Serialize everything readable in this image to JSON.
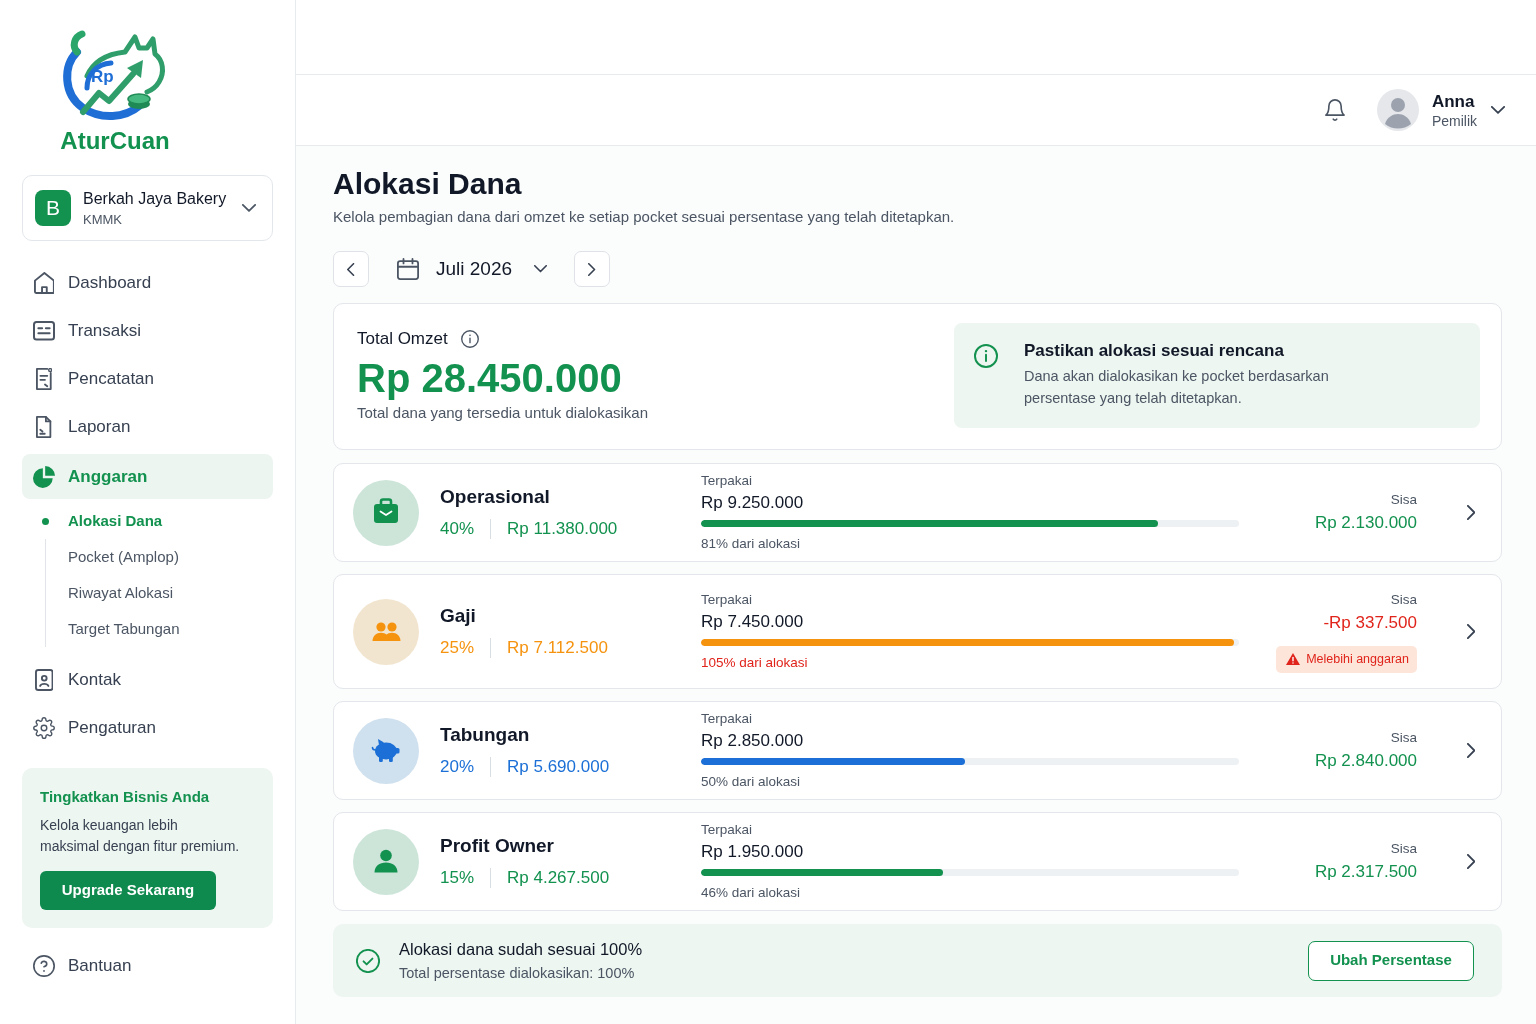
{
  "brand": {
    "mark": "Rp",
    "name": "AturCuan"
  },
  "business": {
    "initial": "B",
    "name": "Berkah Jaya Bakery",
    "type": "KMMK"
  },
  "nav": [
    {
      "kind": "dashboard",
      "label": "Dashboard",
      "selected": false
    },
    {
      "kind": "transactions",
      "label": "Transaksi",
      "selected": false
    },
    {
      "kind": "records",
      "label": "Pencatatan",
      "selected": false
    },
    {
      "kind": "reports",
      "label": "Laporan",
      "selected": false
    },
    {
      "kind": "budget",
      "label": "Anggaran",
      "selected": true,
      "children": [
        {
          "label": "Alokasi Dana",
          "selected": true
        },
        {
          "label": "Pocket (Amplop)",
          "selected": false
        },
        {
          "label": "Riwayat Alokasi",
          "selected": false
        },
        {
          "label": "Target Tabungan",
          "selected": false
        }
      ]
    },
    {
      "kind": "contacts",
      "label": "Kontak",
      "selected": false
    },
    {
      "kind": "settings",
      "label": "Pengaturan",
      "selected": false
    }
  ],
  "upgrade": {
    "title": "Tingkatkan Bisnis Anda",
    "text": "Kelola keuangan lebih maksimal dengan fitur premium.",
    "button": "Upgrade Sekarang"
  },
  "help": {
    "label": "Bantuan"
  },
  "user": {
    "name": "Anna",
    "role": "Pemilik"
  },
  "page": {
    "title": "Alokasi Dana",
    "subtitle": "Kelola pembagian dana dari omzet ke setiap pocket sesuai persentase yang telah ditetapkan."
  },
  "period": {
    "label": "Juli 2026"
  },
  "summary": {
    "label": "Total Omzet",
    "amount": "Rp 28.450.000",
    "caption": "Total dana yang tersedia untuk dialokasikan"
  },
  "notice": {
    "title": "Pastikan alokasi sesuai rencana",
    "text": "Dana akan dialokasikan ke pocket berdasarkan persentase yang telah ditetapkan."
  },
  "pockets": [
    {
      "kind": "operations",
      "name": "Operasional",
      "color": "#12914f",
      "percent": "40%",
      "allocation": "Rp 11.380.000",
      "used_label": "Terpakai",
      "used": "Rp 9.250.000",
      "level": 0.85,
      "usage": "81% dari alokasi",
      "remaining_label": "Sisa",
      "remaining": "Rp 2.130.000",
      "over_budget": false
    },
    {
      "kind": "payroll",
      "name": "Gaji",
      "color": "#f5930f",
      "percent": "25%",
      "allocation": "Rp 7.112.500",
      "used_label": "Terpakai",
      "used": "Rp 7.450.000",
      "level": 0.99,
      "usage": "105% dari alokasi",
      "remaining_label": "Sisa",
      "remaining": "-Rp 337.500",
      "over_budget": true,
      "warning": "Melebihi anggaran"
    },
    {
      "kind": "savings",
      "name": "Tabungan",
      "color": "#1b6fd6",
      "percent": "20%",
      "allocation": "Rp 5.690.000",
      "used_label": "Terpakai",
      "used": "Rp 2.850.000",
      "level": 0.49,
      "usage": "50% dari alokasi",
      "remaining_label": "Sisa",
      "remaining": "Rp 2.840.000",
      "over_budget": false
    },
    {
      "kind": "owner",
      "name": "Profit Owner",
      "color": "#12914f",
      "percent": "15%",
      "allocation": "Rp 4.267.500",
      "used_label": "Terpakai",
      "used": "Rp 1.950.000",
      "level": 0.45,
      "usage": "46% dari alokasi",
      "remaining_label": "Sisa",
      "remaining": "Rp 2.317.500",
      "over_budget": false
    }
  ],
  "allocation_status": {
    "title": "Alokasi dana sudah sesuai 100%",
    "text": "Total persentase dialokasikan: 100%",
    "button": "Ubah Persentase"
  }
}
